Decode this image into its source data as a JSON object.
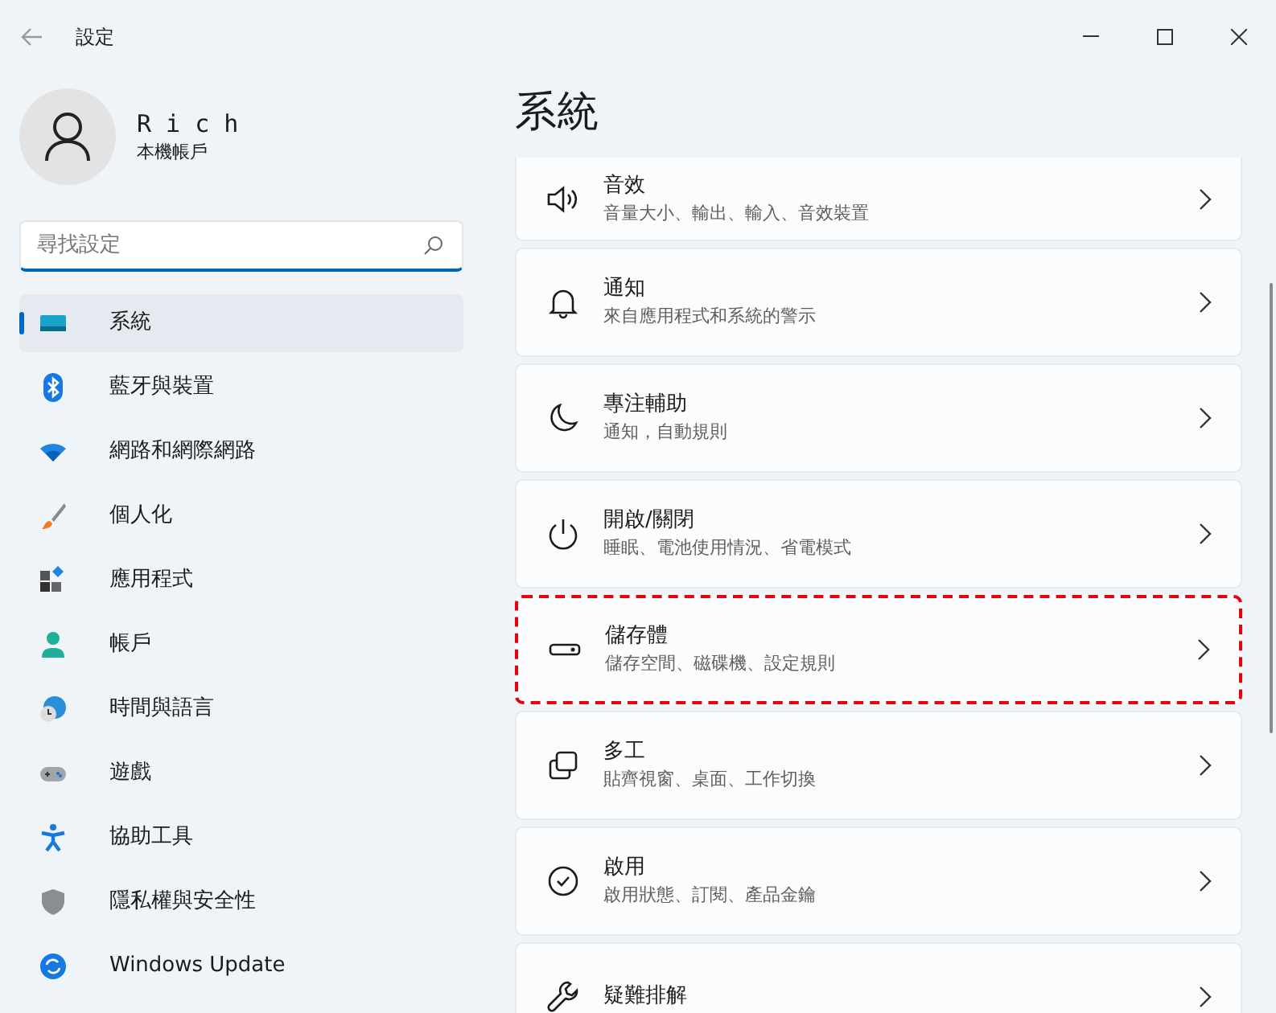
{
  "window": {
    "title": "設定"
  },
  "account": {
    "name": "R i c h",
    "type": "本機帳戶"
  },
  "search": {
    "placeholder": "尋找設定"
  },
  "sidebar": {
    "items": [
      {
        "kind": "system",
        "label": "系統",
        "selected": true
      },
      {
        "kind": "bluetooth",
        "label": "藍牙與裝置",
        "selected": false
      },
      {
        "kind": "wifi",
        "label": "網路和網際網路",
        "selected": false
      },
      {
        "kind": "brush",
        "label": "個人化",
        "selected": false
      },
      {
        "kind": "apps",
        "label": "應用程式",
        "selected": false
      },
      {
        "kind": "person",
        "label": "帳戶",
        "selected": false
      },
      {
        "kind": "clock",
        "label": "時間與語言",
        "selected": false
      },
      {
        "kind": "gamepad",
        "label": "遊戲",
        "selected": false
      },
      {
        "kind": "accessibility",
        "label": "協助工具",
        "selected": false
      },
      {
        "kind": "shield",
        "label": "隱私權與安全性",
        "selected": false
      },
      {
        "kind": "update",
        "label": "Windows Update",
        "selected": false
      }
    ]
  },
  "page": {
    "title": "系統"
  },
  "cards": [
    {
      "kind": "sound",
      "title": "音效",
      "subtitle": "音量大小、輸出、輸入、音效裝置",
      "highlighted": false
    },
    {
      "kind": "bell",
      "title": "通知",
      "subtitle": "來自應用程式和系統的警示",
      "highlighted": false
    },
    {
      "kind": "moon",
      "title": "專注輔助",
      "subtitle": "通知，自動規則",
      "highlighted": false
    },
    {
      "kind": "power",
      "title": "開啟/關閉",
      "subtitle": "睡眠、電池使用情況、省電模式",
      "highlighted": false
    },
    {
      "kind": "storage",
      "title": "儲存體",
      "subtitle": "儲存空間、磁碟機、設定規則",
      "highlighted": true
    },
    {
      "kind": "multitask",
      "title": "多工",
      "subtitle": "貼齊視窗、桌面、工作切換",
      "highlighted": false
    },
    {
      "kind": "check",
      "title": "啟用",
      "subtitle": "啟用狀態、訂閱、產品金鑰",
      "highlighted": false
    },
    {
      "kind": "wrench",
      "title": "疑難排解",
      "highlighted": false
    }
  ]
}
